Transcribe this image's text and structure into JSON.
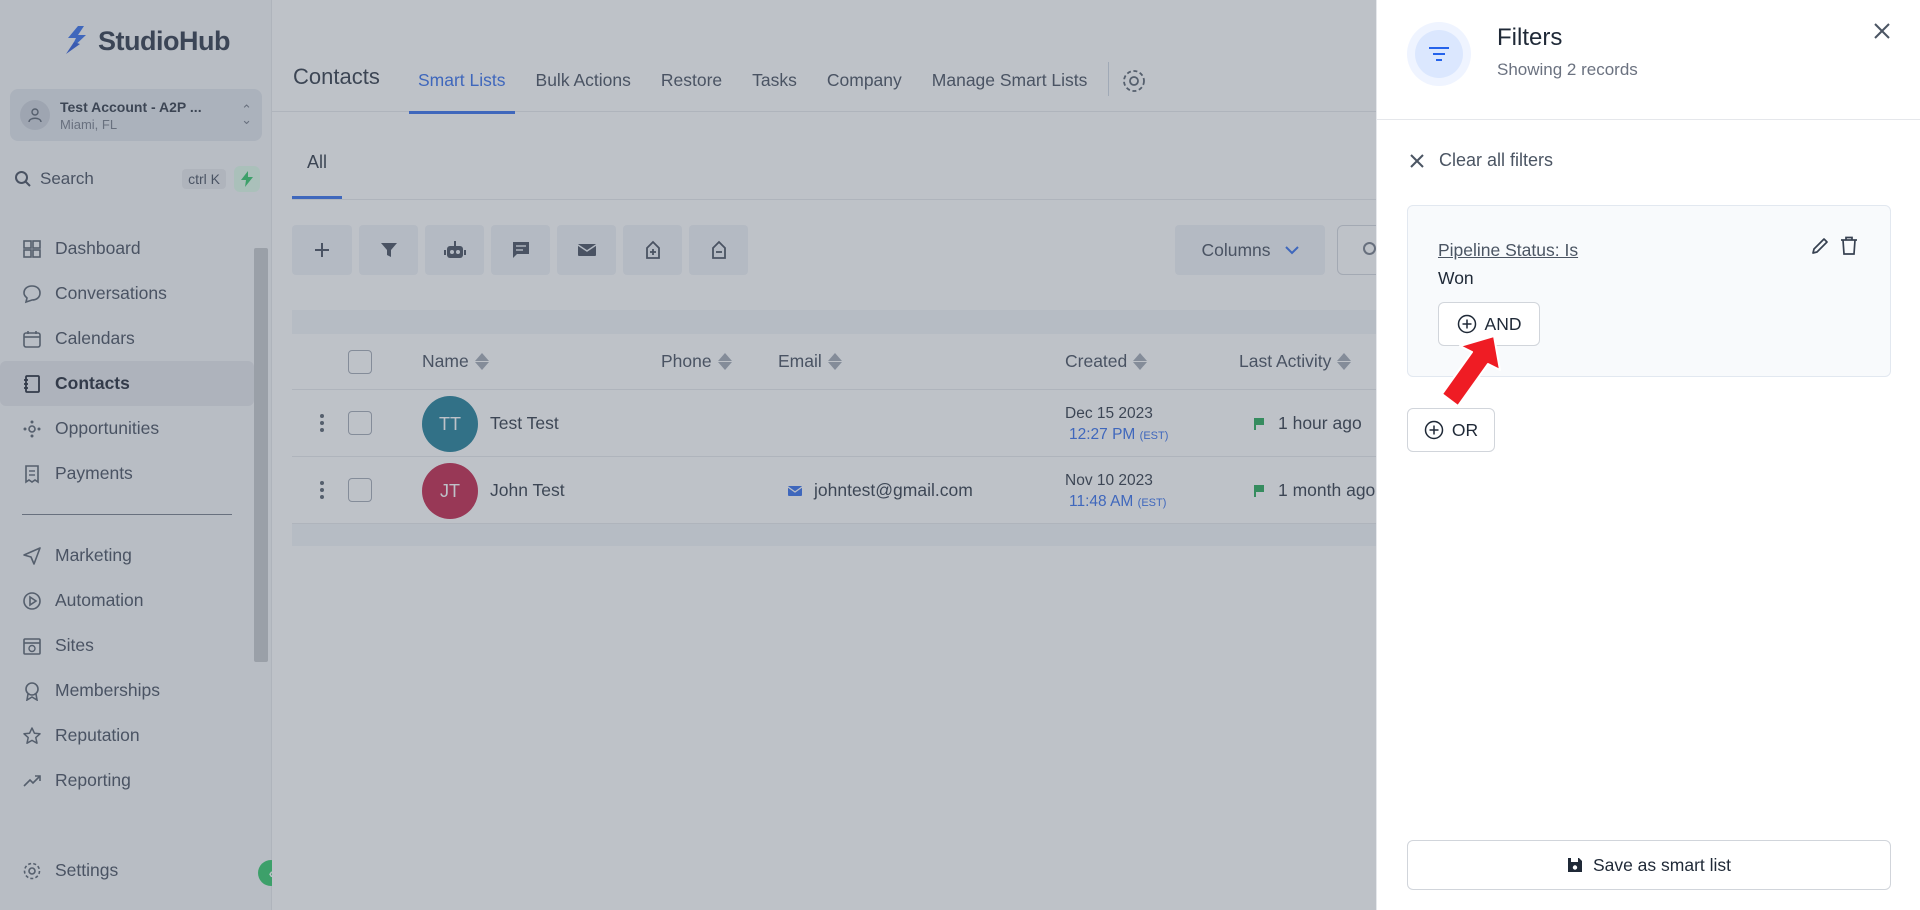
{
  "app": {
    "brand": "StudioHub",
    "brand_color": "#2563eb"
  },
  "sidebar": {
    "account": {
      "name": "Test Account - A2P ...",
      "location": "Miami, FL"
    },
    "search": {
      "label": "Search",
      "shortcut": "ctrl K"
    },
    "items": [
      {
        "label": "Dashboard",
        "icon": "dashboard-icon"
      },
      {
        "label": "Conversations",
        "icon": "chat-bubble-icon"
      },
      {
        "label": "Calendars",
        "icon": "calendar-icon"
      },
      {
        "label": "Contacts",
        "icon": "contacts-book-icon",
        "active": true
      },
      {
        "label": "Opportunities",
        "icon": "opportunities-icon"
      },
      {
        "label": "Payments",
        "icon": "receipt-icon"
      }
    ],
    "items2": [
      {
        "label": "Marketing",
        "icon": "send-icon"
      },
      {
        "label": "Automation",
        "icon": "automation-icon"
      },
      {
        "label": "Sites",
        "icon": "globe-icon"
      },
      {
        "label": "Memberships",
        "icon": "membership-icon"
      },
      {
        "label": "Reputation",
        "icon": "star-icon"
      },
      {
        "label": "Reporting",
        "icon": "trend-icon"
      }
    ],
    "settings_label": "Settings"
  },
  "header": {
    "title": "Contacts",
    "tabs": [
      {
        "label": "Smart Lists",
        "active": true
      },
      {
        "label": "Bulk Actions"
      },
      {
        "label": "Restore"
      },
      {
        "label": "Tasks"
      },
      {
        "label": "Company"
      },
      {
        "label": "Manage Smart Lists"
      }
    ]
  },
  "list": {
    "subtab": "All",
    "columns_button": "Columns",
    "headers": {
      "name": "Name",
      "phone": "Phone",
      "email": "Email",
      "created": "Created",
      "last_activity": "Last Activity"
    },
    "rows": [
      {
        "initials": "TT",
        "avatar_color": "#0e7490",
        "name": "Test Test",
        "email": "",
        "created_date": "Dec 15 2023",
        "created_time": "12:27 PM",
        "tz": "(EST)",
        "activity": "1 hour ago"
      },
      {
        "initials": "JT",
        "avatar_color": "#be123c",
        "name": "John Test",
        "email": "johntest@gmail.com",
        "created_date": "Nov 10 2023",
        "created_time": "11:48 AM",
        "tz": "(EST)",
        "activity": "1 month ago"
      }
    ]
  },
  "filters": {
    "title": "Filters",
    "subtitle": "Showing 2 records",
    "clear_all": "Clear all filters",
    "condition_label": "Pipeline Status:  Is",
    "condition_value": "Won",
    "and_label": "AND",
    "or_label": "OR",
    "save_label": "Save as smart list"
  }
}
